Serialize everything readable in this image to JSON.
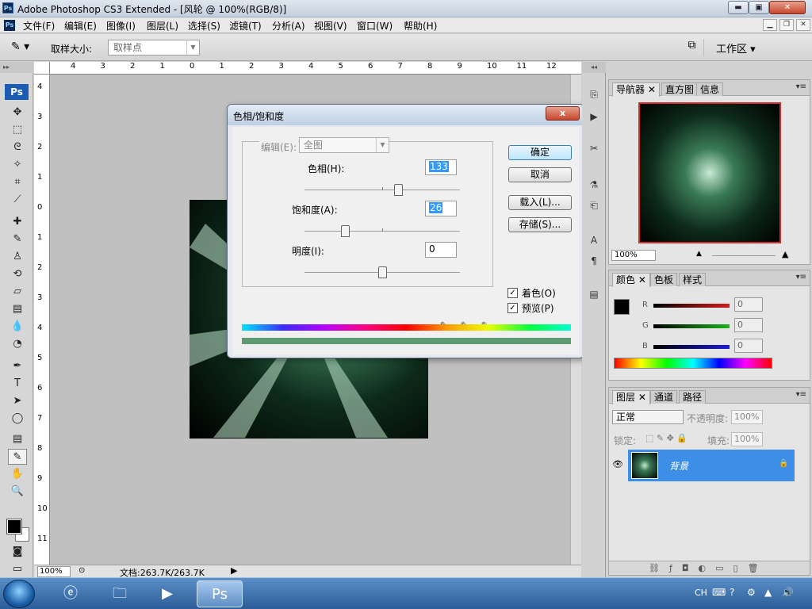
{
  "window": {
    "title": "Adobe Photoshop CS3 Extended - [风轮 @ 100%(RGB/8)]",
    "ps_icon": "Ps",
    "min_glyph": "▬",
    "max_glyph": "▣",
    "close_glyph": "✕"
  },
  "menu": {
    "items": [
      "文件(F)",
      "编辑(E)",
      "图像(I)",
      "图层(L)",
      "选择(S)",
      "滤镜(T)",
      "分析(A)",
      "视图(V)",
      "窗口(W)",
      "帮助(H)"
    ],
    "mdi_min": "▁",
    "mdi_restore": "❐",
    "mdi_close": "✕"
  },
  "options": {
    "sample_size_label": "取样大小:",
    "sample_size_value": "取样点",
    "workspace_label": "工作区 ▾"
  },
  "ruler": {
    "h_ticks": [
      "4",
      "3",
      "2",
      "1",
      "0",
      "1",
      "2",
      "3",
      "4",
      "5",
      "6",
      "7",
      "8",
      "9",
      "10",
      "11",
      "12"
    ],
    "v_ticks": [
      "4",
      "3",
      "2",
      "1",
      "0",
      "1",
      "2",
      "3",
      "4",
      "5",
      "6",
      "7",
      "8",
      "9",
      "10",
      "11"
    ]
  },
  "status": {
    "zoom": "100%",
    "doc_size": "文档:263.7K/263.7K"
  },
  "dialog": {
    "title": "色相/饱和度",
    "close_glyph": "x",
    "edit_label": "编辑(E):",
    "edit_value": "全图",
    "hue_label": "色相(H):",
    "hue_value": "133",
    "hue_fraction": 0.6,
    "saturation_label": "饱和度(A):",
    "saturation_value": "26",
    "saturation_fraction": 0.26,
    "lightness_label": "明度(I):",
    "lightness_value": "0",
    "lightness_fraction": 0.5,
    "ok": "确定",
    "cancel": "取消",
    "load": "载入(L)...",
    "save": "存储(S)...",
    "colorize_label": "着色(O)",
    "colorize_checked": true,
    "preview_label": "预览(P)",
    "preview_checked": true,
    "result_color": "#5e9a72"
  },
  "navigator": {
    "tabs": [
      "导航器",
      "直方图",
      "信息"
    ],
    "zoom": "100%"
  },
  "color_panel": {
    "tabs": [
      "颜色",
      "色板",
      "样式"
    ],
    "channels": [
      {
        "label": "R",
        "value": "0",
        "color": "#d41c1c"
      },
      {
        "label": "G",
        "value": "0",
        "color": "#1cb41c"
      },
      {
        "label": "B",
        "value": "0",
        "color": "#1c1cd4"
      }
    ]
  },
  "layers_panel": {
    "tabs": [
      "图层",
      "通道",
      "路径"
    ],
    "blend_mode": "正常",
    "opacity_label": "不透明度:",
    "opacity_value": "100%",
    "lock_label": "锁定:",
    "fill_label": "填充:",
    "fill_value": "100%",
    "layer_name": "背景"
  },
  "taskbar": {
    "lang": "CH"
  }
}
